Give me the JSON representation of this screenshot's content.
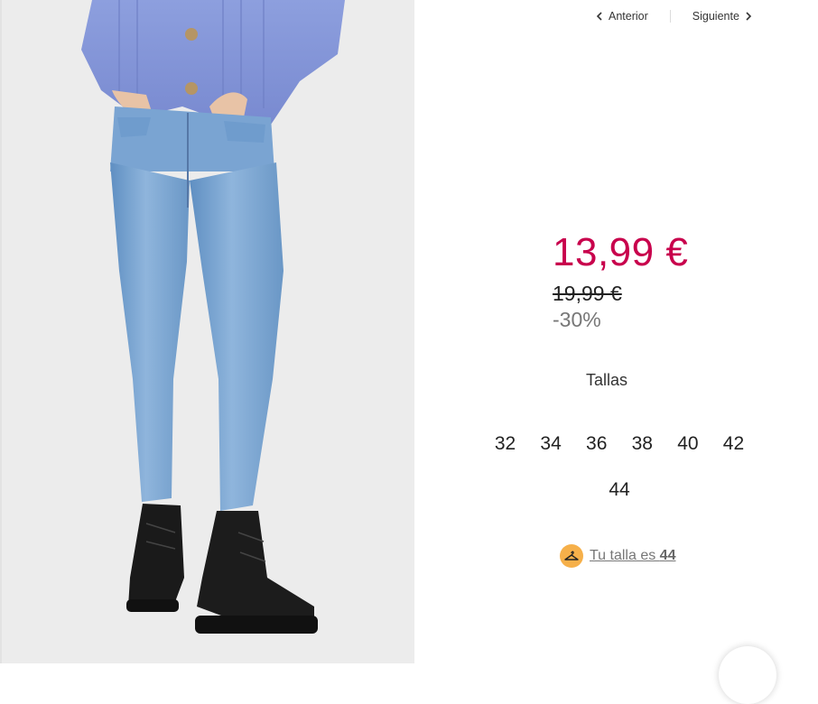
{
  "nav": {
    "prev_label": "Anterior",
    "next_label": "Siguiente"
  },
  "product": {
    "price": "13,99 €",
    "old_price": "19,99 €",
    "discount": "-30%",
    "image_icon": "product-photo-jeans-model"
  },
  "sizes": {
    "title": "Tallas",
    "options": [
      "32",
      "34",
      "36",
      "38",
      "40",
      "42",
      "44"
    ]
  },
  "fit_hint": {
    "icon": "hanger-icon",
    "prefix": "Tu talla es ",
    "size": "44"
  },
  "colors": {
    "price": "#c8004c",
    "badge": "#f6b04a"
  }
}
